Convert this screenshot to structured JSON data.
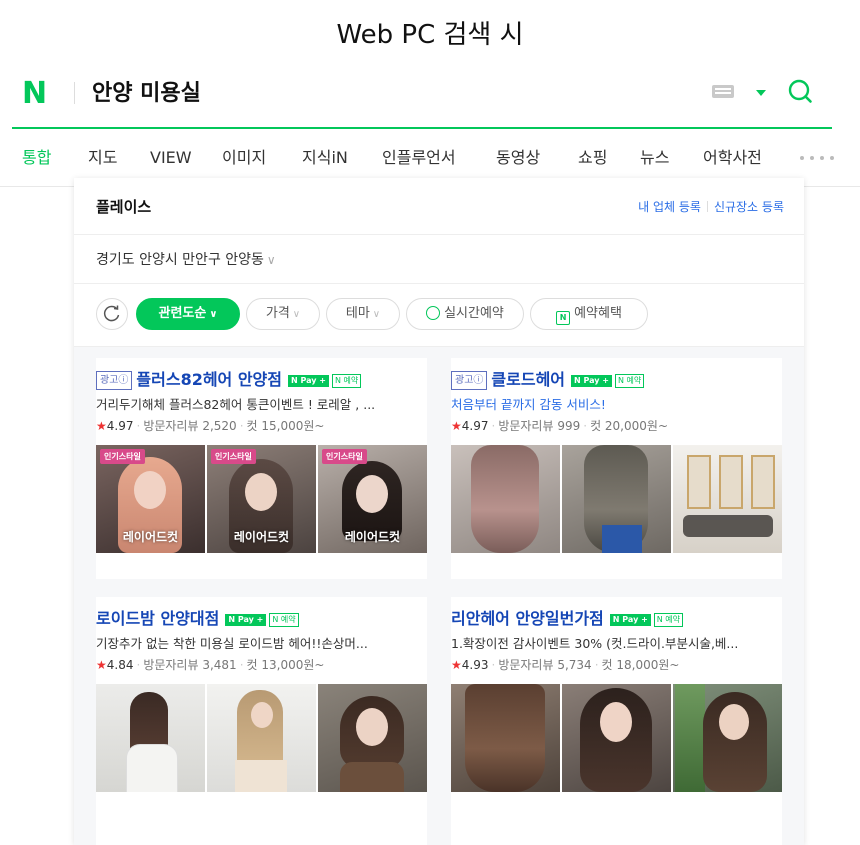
{
  "caption": "Web PC 검색 시",
  "header": {
    "logo": "N",
    "query": "안양 미용실",
    "icons": [
      "keyboard-icon",
      "caret-down-icon",
      "search-icon"
    ],
    "brand_color": "#03c75a"
  },
  "tabs": {
    "items": [
      "통합",
      "지도",
      "VIEW",
      "이미지",
      "지식iN",
      "인플루언서",
      "동영상",
      "쇼핑",
      "뉴스",
      "어학사전"
    ],
    "active": "통합"
  },
  "place": {
    "title": "플레이스",
    "link_register": "내 업체 등록",
    "link_new": "신규장소 등록",
    "location": "경기도 안양시 만안구 안양동",
    "filters": {
      "category": "관련도순",
      "price": "가격",
      "theme": "테마",
      "realtime": "실시간예약",
      "benefit": "예약혜택"
    }
  },
  "cards": [
    {
      "ad": "광고ⓘ",
      "name": "플러스82헤어 안양점",
      "pay": "N Pay +",
      "booking": "N 예약",
      "desc": "거리두기해체 플러스82헤어 통큰이벤트 ! 로레알 , ...",
      "star": "★",
      "rating": "4.97",
      "reviews": "방문자리뷰 2,520",
      "price": "컷 15,000원~",
      "photo_badge": "인기스타일",
      "photo_label": "레이어드컷"
    },
    {
      "ad": "광고ⓘ",
      "name": "클로드헤어",
      "pay": "N Pay +",
      "booking": "N 예약",
      "desc": "처음부터 끝까지 감동 서비스!",
      "star": "★",
      "rating": "4.97",
      "reviews": "방문자리뷰 999",
      "price": "컷 20,000원~"
    },
    {
      "name": "로이드밤 안양대점",
      "pay": "N Pay +",
      "booking": "N 예약",
      "desc": "기장추가 없는 착한 미용실 로이드밤 헤어!!손상머...",
      "star": "★",
      "rating": "4.84",
      "reviews": "방문자리뷰 3,481",
      "price": "컷 13,000원~"
    },
    {
      "name": "리안헤어 안양일번가점",
      "pay": "N Pay +",
      "booking": "N 예약",
      "desc": "1.확장이전 감사이벤트 30% (컷.드라이.부분시술,베...",
      "star": "★",
      "rating": "4.93",
      "reviews": "방문자리뷰 5,734",
      "price": "컷 18,000원~"
    }
  ]
}
